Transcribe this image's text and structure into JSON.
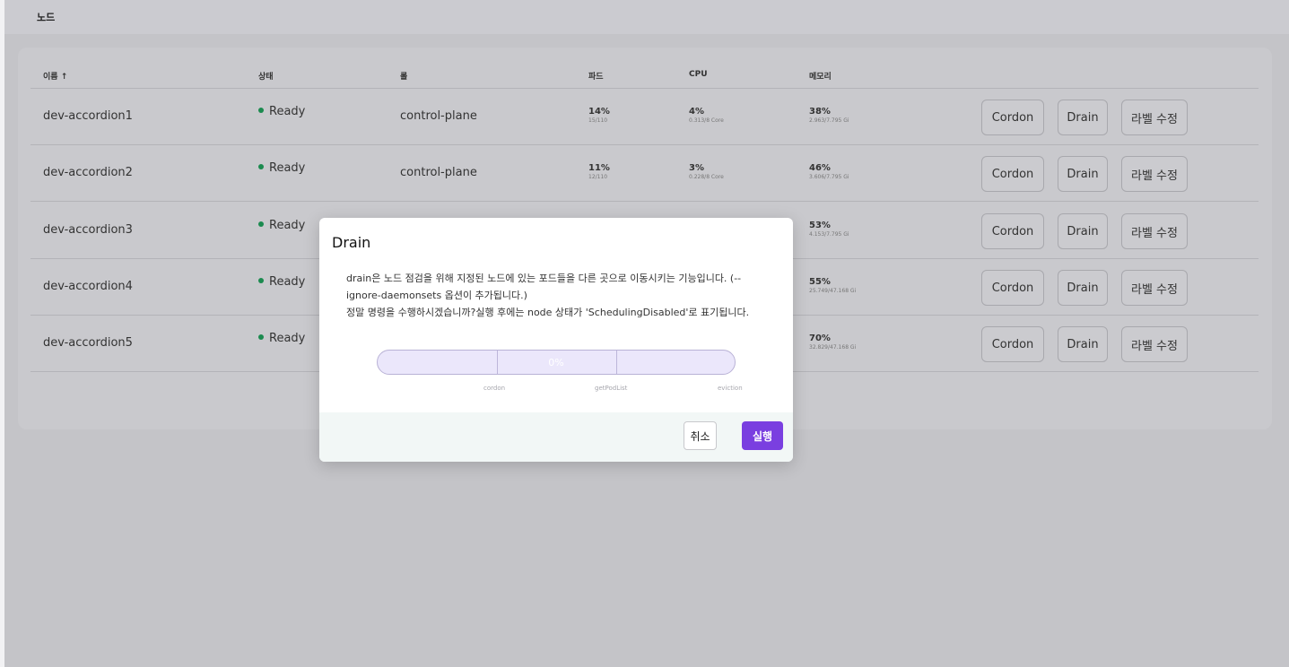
{
  "page": {
    "title": "노드"
  },
  "table": {
    "columns": {
      "name": "이름",
      "sort_icon": "↑",
      "status": "상태",
      "role": "롤",
      "pods": "파드",
      "cpu": "CPU",
      "memory": "메모리"
    },
    "rows": [
      {
        "name": "dev-accordion1",
        "status": "Ready",
        "role": "control-plane",
        "pod_pct": "14%",
        "pod_sub": "15/110",
        "cpu_pct": "4%",
        "cpu_sub": "0.313/8 Core",
        "mem_pct": "38%",
        "mem_sub": "2.963/7.795 Gi"
      },
      {
        "name": "dev-accordion2",
        "status": "Ready",
        "role": "control-plane",
        "pod_pct": "11%",
        "pod_sub": "12/110",
        "cpu_pct": "3%",
        "cpu_sub": "0.228/8 Core",
        "mem_pct": "46%",
        "mem_sub": "3.606/7.795 Gi"
      },
      {
        "name": "dev-accordion3",
        "status": "Ready",
        "role": "",
        "pod_pct": "",
        "pod_sub": "",
        "cpu_pct": "",
        "cpu_sub": "",
        "mem_pct": "53%",
        "mem_sub": "4.153/7.795 Gi"
      },
      {
        "name": "dev-accordion4",
        "status": "Ready",
        "role": "",
        "pod_pct": "",
        "pod_sub": "",
        "cpu_pct": "",
        "cpu_sub": "",
        "mem_pct": "55%",
        "mem_sub": "25.749/47.168 Gi"
      },
      {
        "name": "dev-accordion5",
        "status": "Ready",
        "role": "",
        "pod_pct": "",
        "pod_sub": "",
        "cpu_pct": "",
        "cpu_sub": "",
        "mem_pct": "70%",
        "mem_sub": "32.829/47.168 Gi"
      }
    ],
    "actions": {
      "cordon": "Cordon",
      "drain": "Drain",
      "edit_label": "라벨 수정"
    }
  },
  "modal": {
    "title": "Drain",
    "message_line1": "drain은 노드 점검을 위해 지정된 노드에 있는 포드들을 다른 곳으로 이동시키는 기능입니다. (--",
    "message_line2": "ignore-daemonsets 옵션이 추가됩니다.)",
    "message_line3": "정말 명령을 수행하시겠습니까?실행 후에는 node 상태가 'SchedulingDisabled'로 표기됩니다.",
    "progress_text": "0%",
    "progress_value": 0,
    "steps": [
      "cordon",
      "getPodList",
      "eviction"
    ],
    "cancel": "취소",
    "confirm": "실행"
  },
  "colors": {
    "accent": "#7a3fe0",
    "ready": "#1b8a4f",
    "progress_track": "#ebe7fb"
  }
}
